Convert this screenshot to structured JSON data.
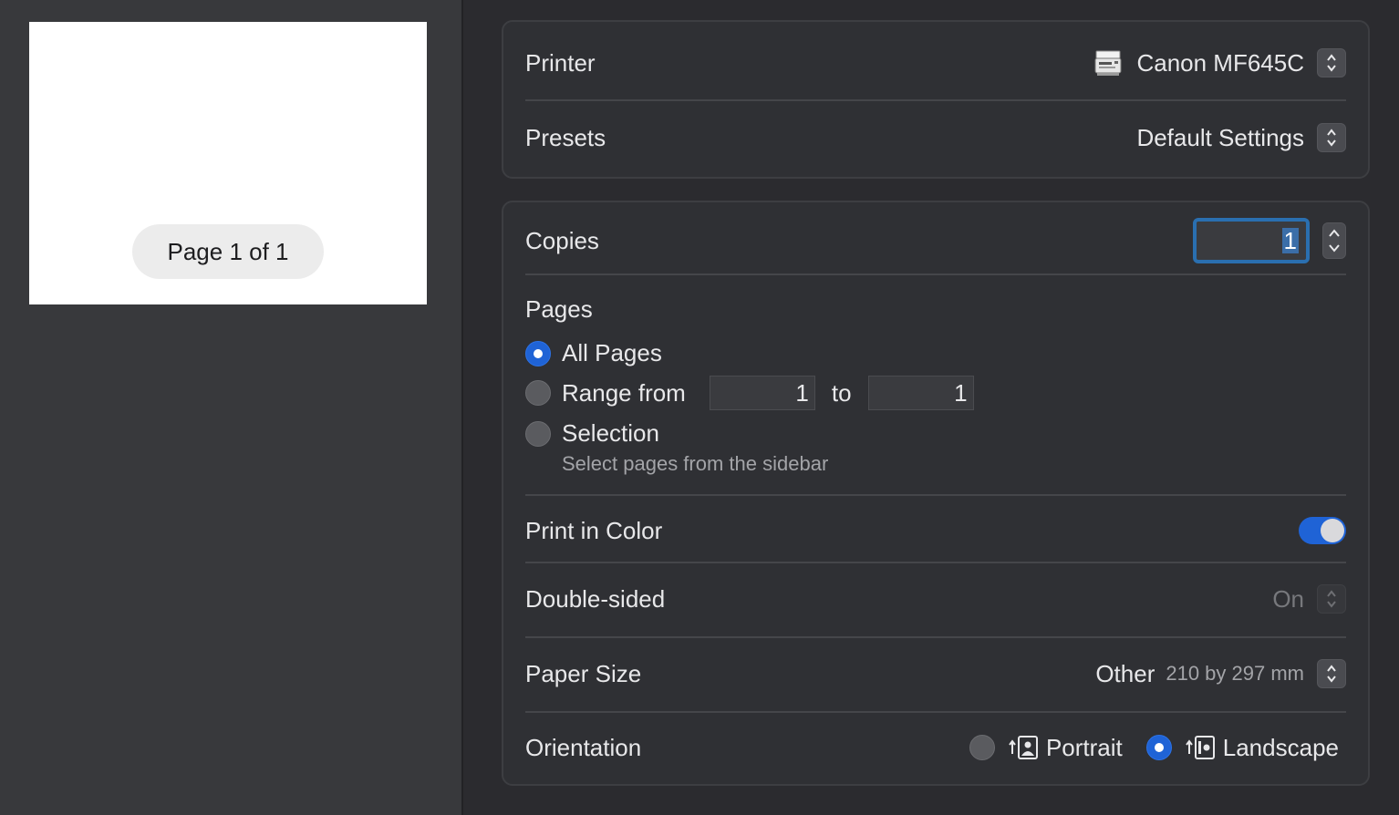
{
  "preview": {
    "page_indicator": "Page 1 of 1"
  },
  "printer": {
    "label": "Printer",
    "value": "Canon MF645C",
    "icon": "printer-icon"
  },
  "presets": {
    "label": "Presets",
    "value": "Default Settings"
  },
  "copies": {
    "label": "Copies",
    "value": "1"
  },
  "pages": {
    "title": "Pages",
    "all_pages_label": "All Pages",
    "range_label": "Range from",
    "range_from": "1",
    "range_to_label": "to",
    "range_to": "1",
    "selection_label": "Selection",
    "selection_hint": "Select pages from the sidebar",
    "selected": "all"
  },
  "print_in_color": {
    "label": "Print in Color",
    "enabled": true
  },
  "double_sided": {
    "label": "Double-sided",
    "value": "On",
    "disabled": true
  },
  "paper_size": {
    "label": "Paper Size",
    "value": "Other",
    "detail": "210 by 297 mm"
  },
  "orientation": {
    "label": "Orientation",
    "portrait_label": "Portrait",
    "landscape_label": "Landscape",
    "selected": "landscape"
  },
  "colors": {
    "accent": "#1f63d6",
    "focus_ring": "#2a6fb0",
    "panel_bg": "#2f3034",
    "sidebar_bg": "#38393c"
  }
}
